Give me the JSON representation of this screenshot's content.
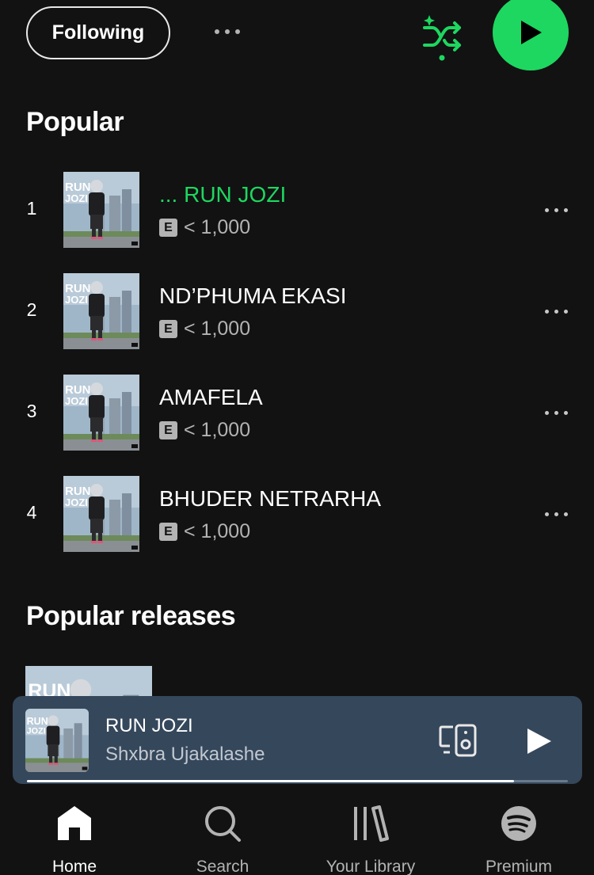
{
  "header": {
    "follow_label": "Following",
    "more_icon": "more-horizontal-icon",
    "shuffle_icon": "smart-shuffle-icon",
    "play_icon": "play-icon",
    "accent_color": "#1ed760"
  },
  "popular": {
    "title": "Popular",
    "tracks": [
      {
        "number": "1",
        "title": "... RUN JOZI",
        "explicit": "E",
        "plays": "< 1,000",
        "playing": true
      },
      {
        "number": "2",
        "title": "ND’PHUMA EKASI",
        "explicit": "E",
        "plays": "< 1,000",
        "playing": false
      },
      {
        "number": "3",
        "title": "AMAFELA",
        "explicit": "E",
        "plays": "< 1,000",
        "playing": false
      },
      {
        "number": "4",
        "title": "BHUDER NETRARHA",
        "explicit": "E",
        "plays": "< 1,000",
        "playing": false
      }
    ]
  },
  "releases": {
    "title": "Popular releases"
  },
  "cover_art": {
    "label": "RUN JOZI",
    "artist_caption": "SHXBRA UJAKALASHE"
  },
  "now_playing": {
    "title": "RUN JOZI",
    "artist": "Shxbra Ujakalashe",
    "progress": 0.9,
    "device_icon": "connect-device-icon",
    "play_icon": "play-icon",
    "background": "#35475b"
  },
  "nav": {
    "items": [
      {
        "label": "Home",
        "icon": "home-icon",
        "active": true
      },
      {
        "label": "Search",
        "icon": "search-icon",
        "active": false
      },
      {
        "label": "Your Library",
        "icon": "library-icon",
        "active": false
      },
      {
        "label": "Premium",
        "icon": "spotify-icon",
        "active": false
      }
    ]
  }
}
